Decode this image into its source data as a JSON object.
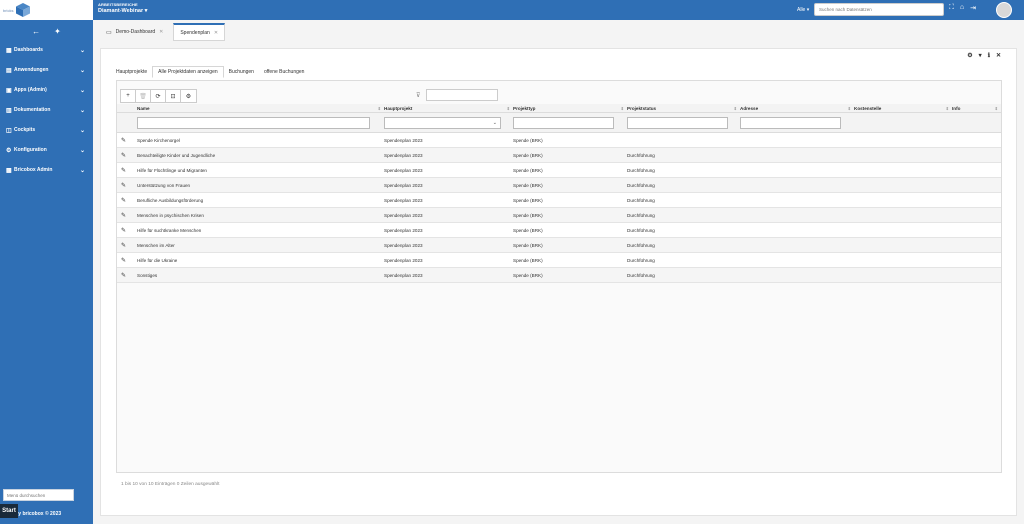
{
  "brand": {
    "logo_text": "bricks",
    "footer": "ed by bricobox © 2023",
    "start": "Start"
  },
  "sidebar": {
    "search_placeholder": "Menü durchsuchen",
    "items": [
      {
        "label": "Dashboards",
        "icon": "dashboard-icon"
      },
      {
        "label": "Anwendungen",
        "icon": "apps-icon"
      },
      {
        "label": "Apps (Admin)",
        "icon": "admin-apps-icon"
      },
      {
        "label": "Dokumentation",
        "icon": "document-icon"
      },
      {
        "label": "Cockpits",
        "icon": "cockpit-icon"
      },
      {
        "label": "Konfiguration",
        "icon": "config-icon"
      },
      {
        "label": "Bricobox Admin",
        "icon": "admin-icon"
      }
    ]
  },
  "topbar": {
    "area_small": "ARBEITSBEREICHE",
    "area_name": "Diamant-Webinar ▾",
    "scope": "Alle ▾",
    "search_placeholder": "Suchen nach Datensätzen"
  },
  "tabs": [
    {
      "label": "Demo-Dashboard"
    },
    {
      "label": "Spendenplan"
    }
  ],
  "subtabs": [
    "Hauptprojekte",
    "Alle Projektdaten anzeigen",
    "Buchungen",
    "offene Buchungen"
  ],
  "table": {
    "columns": [
      "Name",
      "Hauptprojekt",
      "Projekttyp",
      "Projektstatus",
      "Adresse",
      "Kostenstelle",
      "Info"
    ],
    "rows": [
      {
        "name": "Spende Kirchenorgel",
        "hauptprojekt": "Spendenplan 2023",
        "typ": "Spende (BRK)",
        "status": ""
      },
      {
        "name": "Benachteiligte Kinder und Jugendliche",
        "hauptprojekt": "Spendenplan 2023",
        "typ": "Spende (BRK)",
        "status": "Durchführung"
      },
      {
        "name": "Hilfe für Flüchtlinge und Migranten",
        "hauptprojekt": "Spendenplan 2023",
        "typ": "Spende (BRK)",
        "status": "Durchführung"
      },
      {
        "name": "Unterstützung von Frauen",
        "hauptprojekt": "Spendenplan 2023",
        "typ": "Spende (BRK)",
        "status": "Durchführung"
      },
      {
        "name": "Berufliche Ausbildungsförderung",
        "hauptprojekt": "Spendenplan 2023",
        "typ": "Spende (BRK)",
        "status": "Durchführung"
      },
      {
        "name": "Menschen in psychischen Krisen",
        "hauptprojekt": "Spendenplan 2023",
        "typ": "Spende (BRK)",
        "status": "Durchführung"
      },
      {
        "name": "Hilfe für suchtkranke Menschen",
        "hauptprojekt": "Spendenplan 2023",
        "typ": "Spende (BRK)",
        "status": "Durchführung"
      },
      {
        "name": "Menschen im Alter",
        "hauptprojekt": "Spendenplan 2023",
        "typ": "Spende (BRK)",
        "status": "Durchführung"
      },
      {
        "name": "Hilfe für die Ukraine",
        "hauptprojekt": "Spendenplan 2023",
        "typ": "Spende (BRK)",
        "status": "Durchführung"
      },
      {
        "name": "Sonstiges",
        "hauptprojekt": "Spendenplan 2023",
        "typ": "Spende (BRK)",
        "status": "Durchführung"
      }
    ]
  },
  "footer_info": "1 bis 10 von 10 Einträgen    0 Zeilen ausgewählt",
  "colors": {
    "primary": "#2f6fb5"
  }
}
